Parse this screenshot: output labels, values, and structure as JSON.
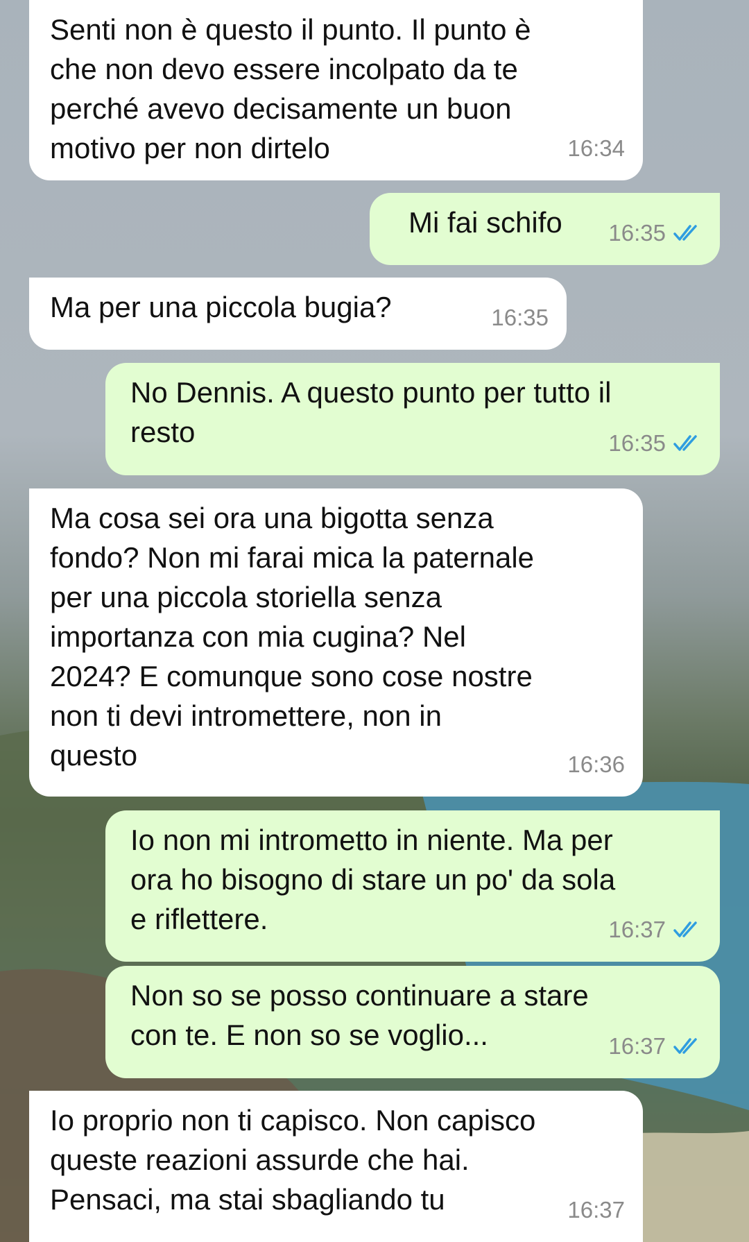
{
  "messages": [
    {
      "text": "Senti non è questo il punto. Il punto è\nche non devo essere incolpato da te\nperché avevo decisamente un buon\nmotivo per non dirtelo",
      "time": "16:34"
    },
    {
      "text": "Mi fai schifo",
      "time": "16:35"
    },
    {
      "text": "Ma per una piccola bugia?",
      "time": "16:35"
    },
    {
      "text": "No Dennis. A questo punto per tutto il\nresto",
      "time": "16:35"
    },
    {
      "text": "Ma cosa sei ora una bigotta senza\nfondo? Non mi farai mica la paternale\nper una piccola storiella senza\nimportanza con mia cugina? Nel\n2024? E comunque sono cose nostre\nnon ti devi intromettere, non in\nquesto",
      "time": "16:36"
    },
    {
      "text": "Io non mi intrometto in niente. Ma per\nora ho bisogno di stare un po' da sola\ne riflettere.",
      "time": "16:37"
    },
    {
      "text": "Non so se posso continuare a stare\ncon te. E non so se voglio...",
      "time": "16:37"
    },
    {
      "text": "Io proprio non ti capisco. Non capisco\nqueste reazioni assurde che hai.\nPensaci, ma stai sbagliando tu",
      "time": "16:37"
    }
  ],
  "colors": {
    "incoming_bubble": "#ffffff",
    "outgoing_bubble": "#e2fdd1",
    "read_ticks": "#2f9de0",
    "timestamp": "#8a8a8a"
  },
  "icons": {
    "read_receipt": "double-check-icon"
  }
}
